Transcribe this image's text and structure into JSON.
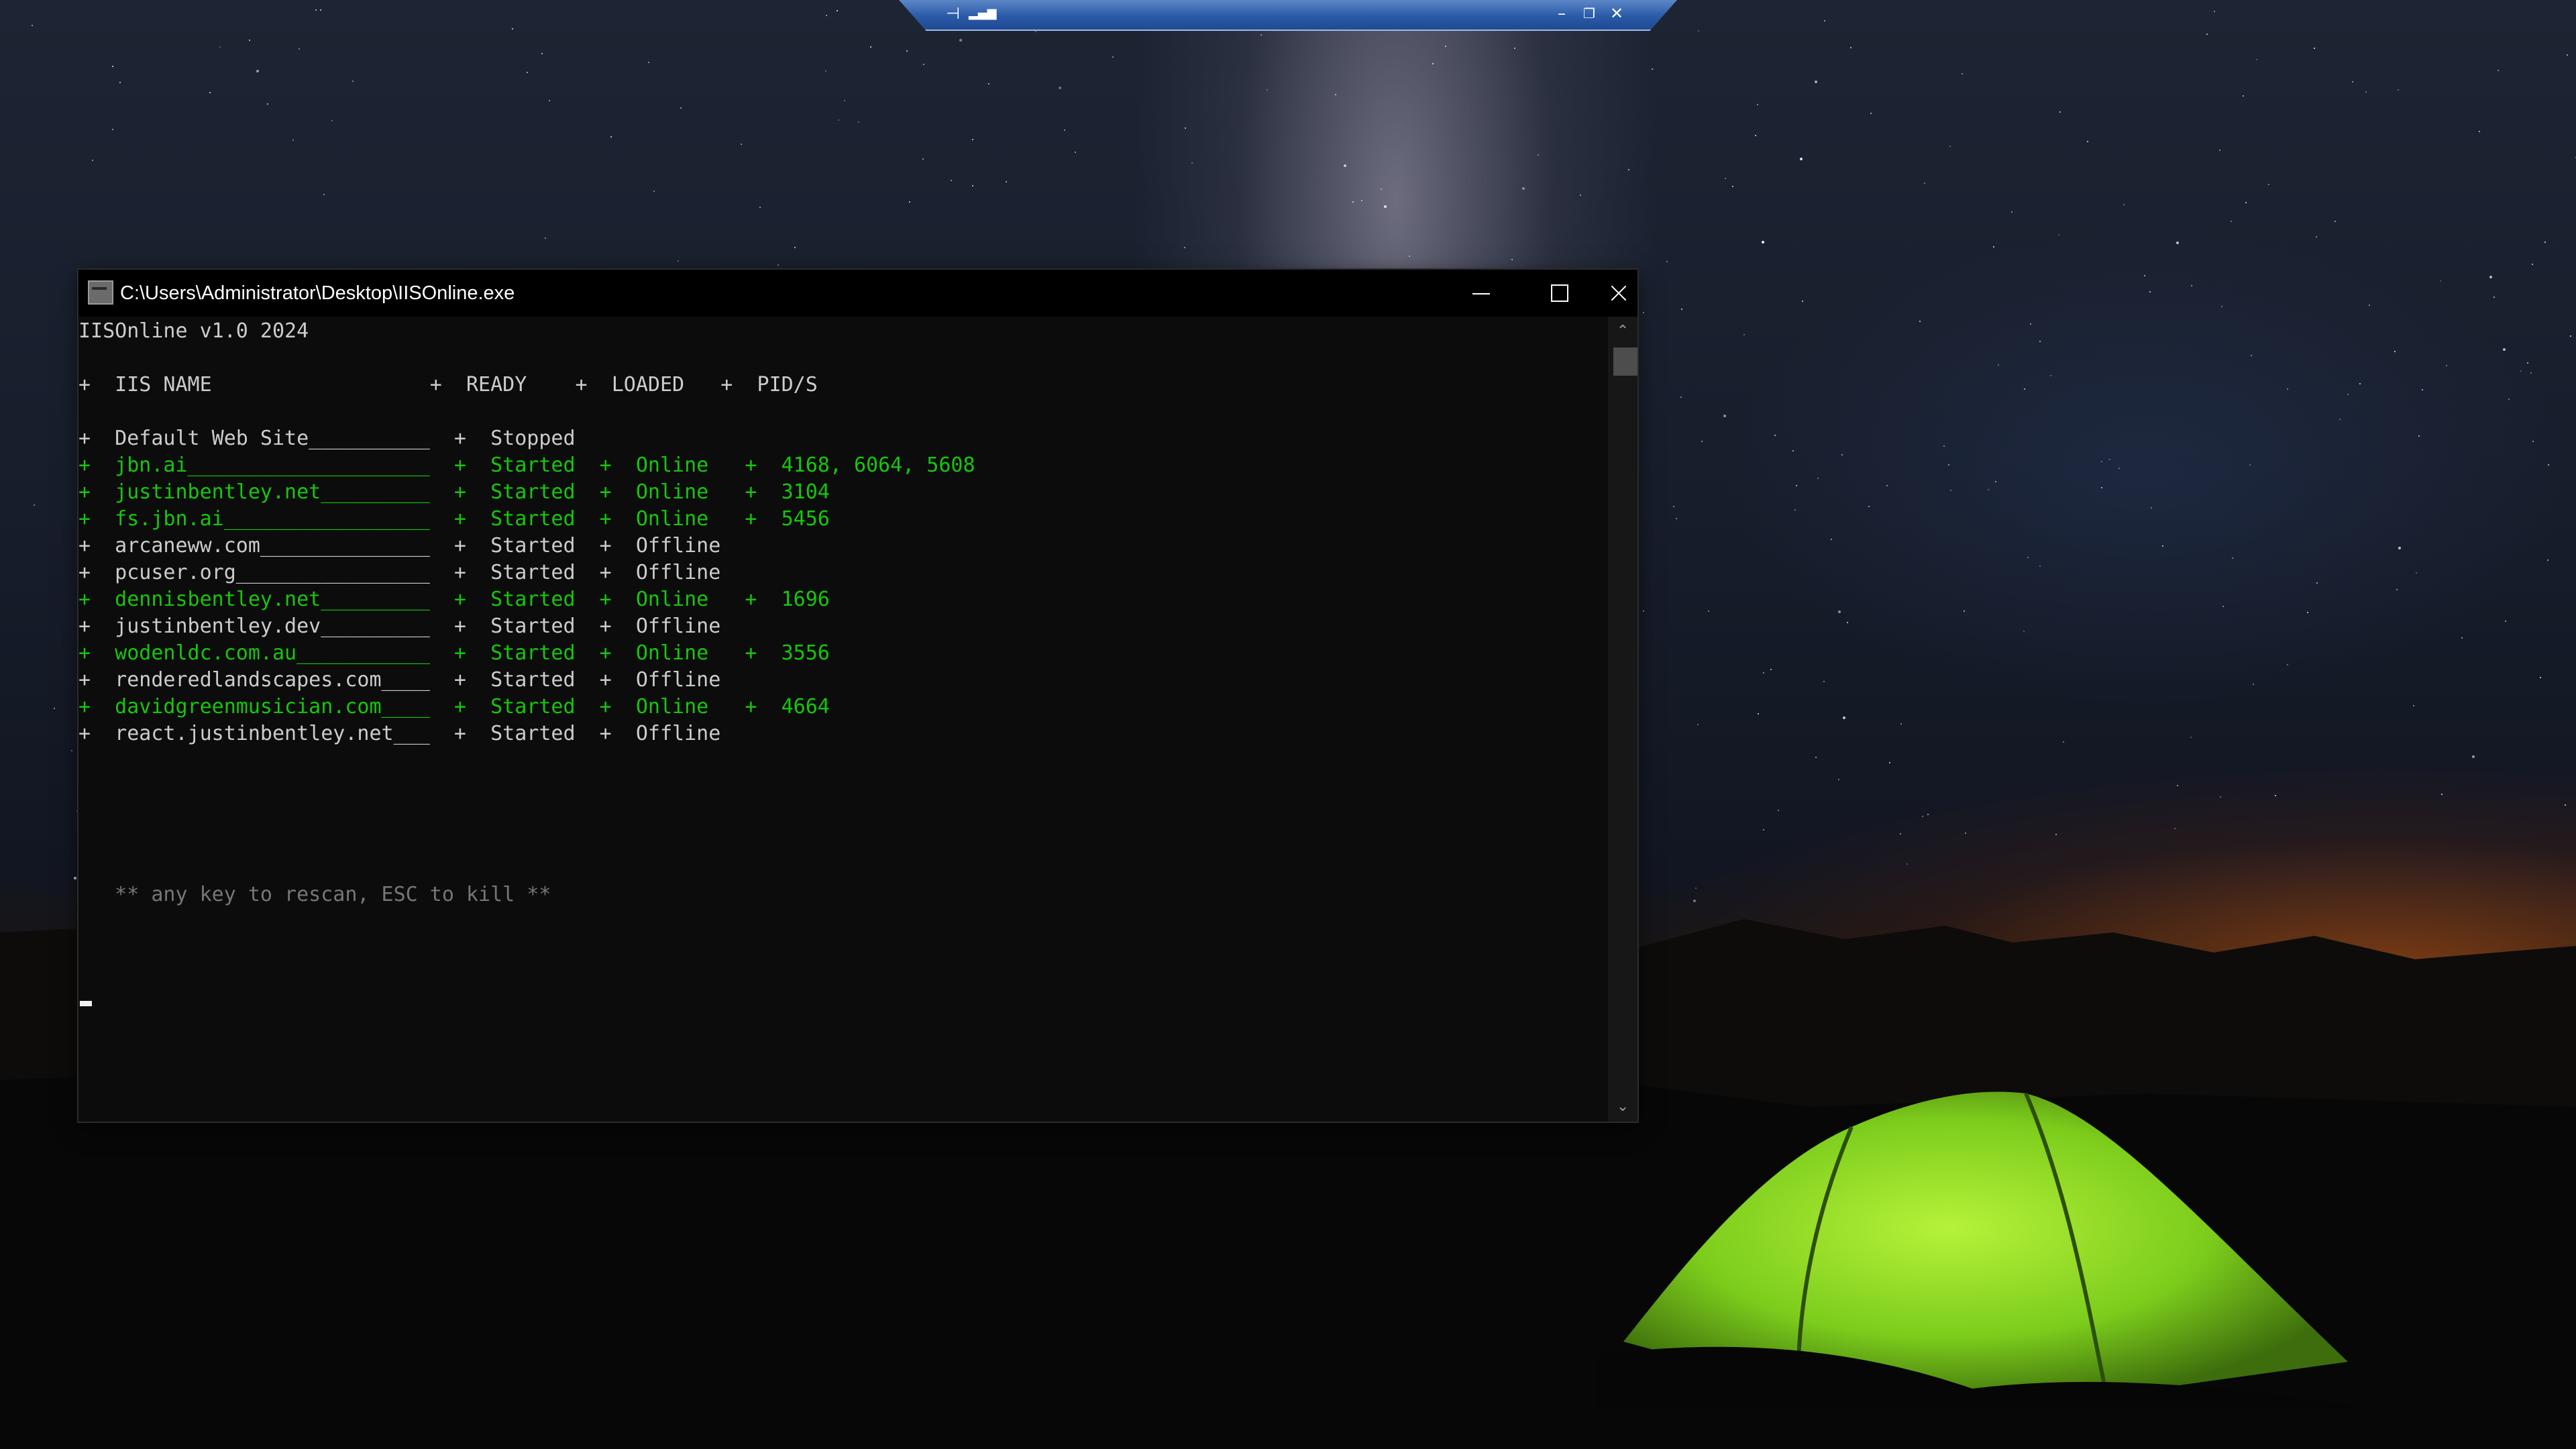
{
  "rdp_bar": {
    "pin_icon": "pin-icon",
    "signal_icon": "signal-icon",
    "minimize_icon": "minimize-icon",
    "restore_icon": "restore-icon",
    "close_icon": "close-icon"
  },
  "window": {
    "title": "C:\\Users\\Administrator\\Desktop\\IISOnline.exe",
    "icon": "console-icon"
  },
  "console": {
    "banner": "IISOnline v1.0 2024",
    "header": "+  IIS NAME                  +  READY    +  LOADED   +  PID/S",
    "rows": [
      {
        "text": "+  Default Web Site__________  +  Stopped",
        "status": "stopped"
      },
      {
        "text": "+  jbn.ai____________________  +  Started  +  Online   +  4168, 6064, 5608",
        "status": "online"
      },
      {
        "text": "+  justinbentley.net_________  +  Started  +  Online   +  3104",
        "status": "online"
      },
      {
        "text": "+  fs.jbn.ai_________________  +  Started  +  Online   +  5456",
        "status": "online"
      },
      {
        "text": "+  arcaneww.com______________  +  Started  +  Offline",
        "status": "offline"
      },
      {
        "text": "+  pcuser.org________________  +  Started  +  Offline",
        "status": "offline"
      },
      {
        "text": "+  dennisbentley.net_________  +  Started  +  Online   +  1696",
        "status": "online"
      },
      {
        "text": "+  justinbentley.dev_________  +  Started  +  Offline",
        "status": "offline"
      },
      {
        "text": "+  wodenldc.com.au___________  +  Started  +  Online   +  3556",
        "status": "online"
      },
      {
        "text": "+  renderedlandscapes.com____  +  Started  +  Offline",
        "status": "offline"
      },
      {
        "text": "+  davidgreenmusician.com____  +  Started  +  Online   +  4664",
        "status": "online"
      },
      {
        "text": "+  react.justinbentley.net___  +  Started  +  Offline",
        "status": "offline"
      }
    ],
    "hint": "   ** any key to rescan, ESC to kill **"
  },
  "colors": {
    "online": "#16c60c",
    "default_text": "#cccccc",
    "hint": "#767676",
    "console_bg": "#0c0c0c"
  }
}
